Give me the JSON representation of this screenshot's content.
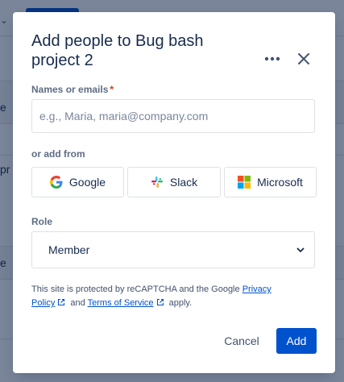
{
  "dialog": {
    "title": "Add people to Bug bash project 2",
    "names_label": "Names or emails",
    "required_marker": "*",
    "names_placeholder": "e.g., Maria, maria@company.com",
    "names_value": "",
    "add_from_label": "or add from",
    "providers": [
      {
        "label": "Google",
        "icon": "google-icon"
      },
      {
        "label": "Slack",
        "icon": "slack-icon"
      },
      {
        "label": "Microsoft",
        "icon": "microsoft-icon"
      }
    ],
    "role_label": "Role",
    "role_value": "Member",
    "legal": {
      "prefix": "This site is protected by reCAPTCHA and the Google ",
      "privacy_link": "Privacy Policy",
      "middle": " and ",
      "terms_link": "Terms of Service",
      "suffix": " apply."
    },
    "cancel_label": "Cancel",
    "add_label": "Add"
  },
  "colors": {
    "primary": "#0052cc",
    "required": "#de350b",
    "text": "#172b4d",
    "subtle_text": "#5e6c84",
    "overlay": "rgba(9,30,66,0.54)"
  }
}
